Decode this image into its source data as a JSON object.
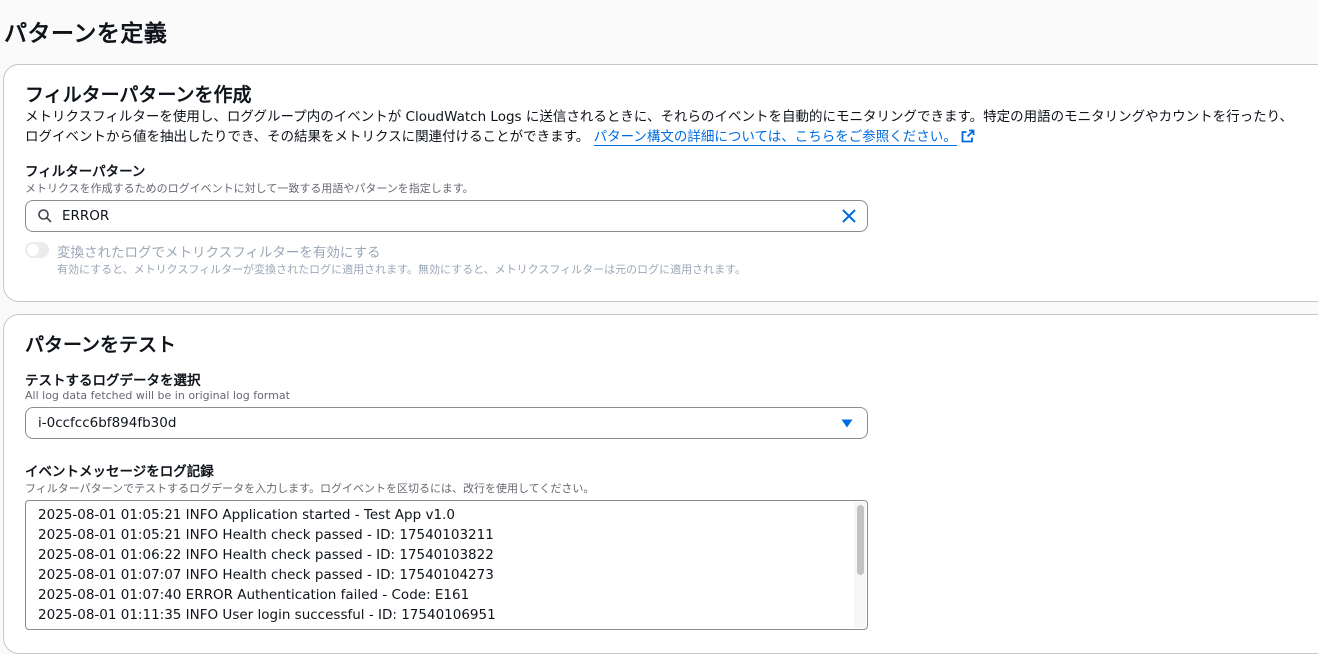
{
  "page": {
    "title": "パターンを定義"
  },
  "filter_card": {
    "title": "フィルターパターンを作成",
    "description": "メトリクスフィルターを使用し、ロググループ内のイベントが CloudWatch Logs に送信されるときに、それらのイベントを自動的にモニタリングできます。特定の用語のモニタリングやカウントを行ったり、ログイベントから値を抽出したりでき、その結果をメトリクスに関連付けることができます。",
    "link_text": "パターン構文の詳細については、こちらをご参照ください。",
    "pattern_label": "フィルターパターン",
    "pattern_sublabel": "メトリクスを作成するためのログイベントに対して一致する用語やパターンを指定します。",
    "pattern_value": "ERROR",
    "toggle_label": "変換されたログでメトリクスフィルターを有効にする",
    "toggle_description": "有効にすると、メトリクスフィルターが変換されたログに適用されます。無効にすると、メトリクスフィルターは元のログに適用されます。",
    "toggle_on": false
  },
  "test_card": {
    "title": "パターンをテスト",
    "select_label": "テストするログデータを選択",
    "select_sublabel": "All log data fetched will be in original log format",
    "select_value": "i-0ccfcc6bf894fb30d",
    "events_label": "イベントメッセージをログ記録",
    "events_sublabel": "フィルターパターンでテストするログデータを入力します。ログイベントを区切るには、改行を使用してください。",
    "log_lines": [
      "2025-08-01 01:05:21 INFO Application started - Test App v1.0",
      "2025-08-01 01:05:21 INFO Health check passed - ID: 17540103211",
      "2025-08-01 01:06:22 INFO Health check passed - ID: 17540103822",
      "2025-08-01 01:07:07 INFO Health check passed - ID: 17540104273",
      "2025-08-01 01:07:40 ERROR Authentication failed - Code: E161",
      "2025-08-01 01:11:35 INFO User login successful - ID: 17540106951"
    ]
  },
  "colors": {
    "link": "#006ce0",
    "text": "#0f141a",
    "muted": "#656871",
    "disabled": "#9ba7b6"
  },
  "icons": {
    "search": "search-icon",
    "clear": "close-icon",
    "external": "external-link-icon",
    "caret": "caret-down-icon"
  }
}
